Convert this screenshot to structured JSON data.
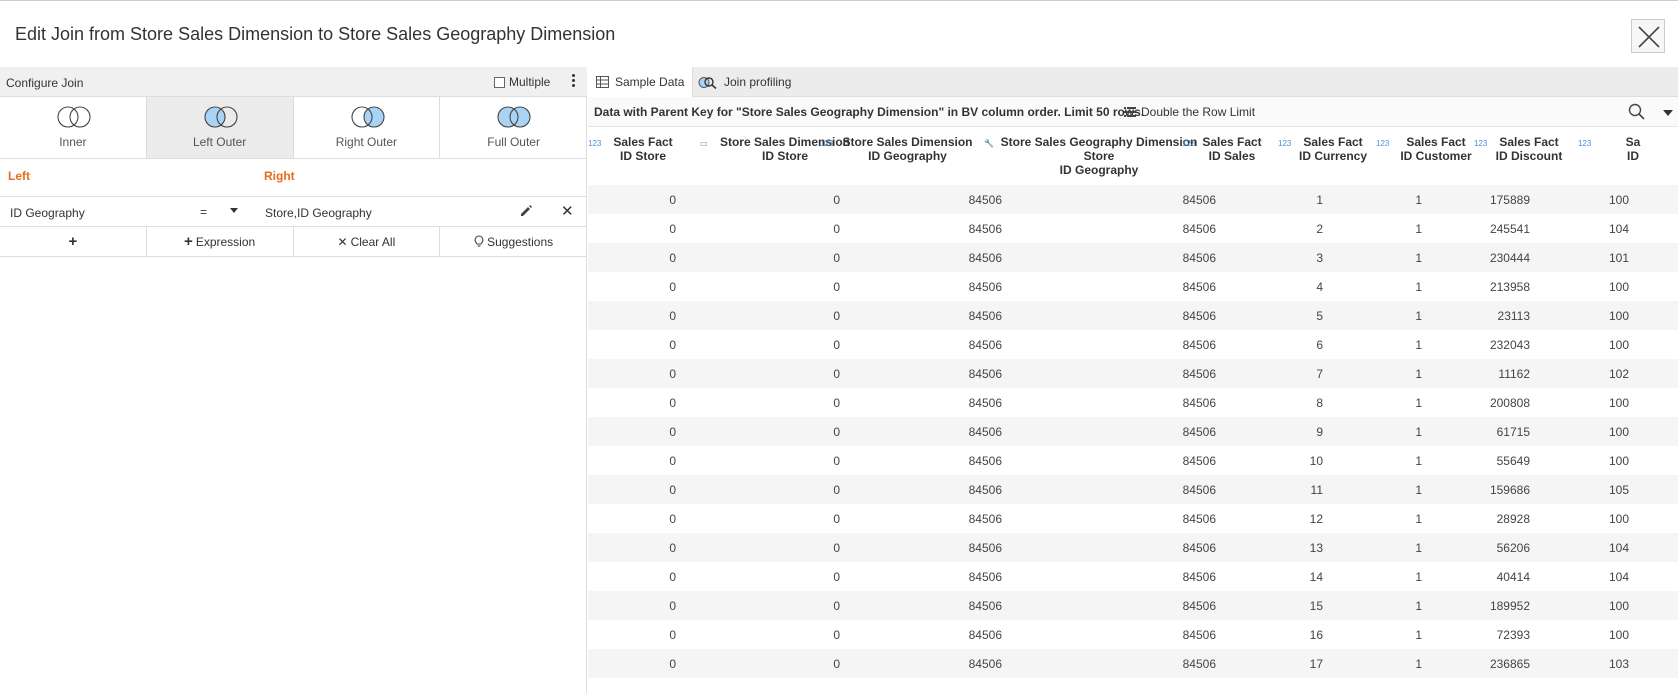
{
  "dialog": {
    "title": "Edit Join from Store Sales Dimension to Store Sales Geography Dimension",
    "close_icon": "close-icon"
  },
  "config": {
    "title": "Configure Join",
    "multiple_label": "Multiple",
    "multiple_checked": false,
    "join_types": [
      {
        "label": "Inner",
        "active": false,
        "fill": "inner"
      },
      {
        "label": "Left Outer",
        "active": true,
        "fill": "left"
      },
      {
        "label": "Right Outer",
        "active": false,
        "fill": "right"
      },
      {
        "label": "Full Outer",
        "active": false,
        "fill": "full"
      }
    ],
    "left_label": "Left",
    "right_label": "Right",
    "condition": {
      "left": "ID Geography",
      "operator": "=",
      "right": "Store,ID Geography"
    },
    "actions": {
      "add": "+",
      "expression": "Expression",
      "clear_all": "Clear All",
      "suggestions": "Suggestions"
    }
  },
  "tabs": [
    {
      "label": "Sample Data",
      "icon": "table-icon",
      "active": true
    },
    {
      "label": "Join profiling",
      "icon": "profiling-icon",
      "active": false
    }
  ],
  "info": {
    "text": "Data with Parent Key for \"Store Sales Geography Dimension\" in BV column order. Limit 50 rows.",
    "double_label": "Double the Row Limit"
  },
  "colors": {
    "accent_orange": "#e86b1f",
    "venn_fill": "#a9d3f5",
    "icon_blue": "#4a90d9"
  },
  "columns": [
    {
      "lines": [
        "Sales Fact",
        "ID Store"
      ],
      "icon": "numeric-icon"
    },
    {
      "lines": [
        "Store Sales Dimension",
        "ID Store"
      ],
      "icon": "key-icon"
    },
    {
      "lines": [
        "Store Sales Dimension",
        "ID Geography"
      ],
      "icon": "numeric-icon"
    },
    {
      "lines": [
        "Store Sales Geography Dimension",
        "Store",
        "ID Geography"
      ],
      "icon": "wrench-key-icon"
    },
    {
      "lines": [
        "Sales Fact",
        "ID Sales"
      ],
      "icon": "numeric-icon"
    },
    {
      "lines": [
        "Sales Fact",
        "ID Currency"
      ],
      "icon": "numeric-icon"
    },
    {
      "lines": [
        "Sales Fact",
        "ID Customer"
      ],
      "icon": "numeric-icon"
    },
    {
      "lines": [
        "Sales Fact",
        "ID Discount"
      ],
      "icon": "numeric-icon"
    },
    {
      "lines": [
        "Sa",
        "ID"
      ],
      "icon": "numeric-icon"
    }
  ],
  "rows": [
    [
      "0",
      "0",
      "84506",
      "84506",
      "1",
      "1",
      "175889",
      "100"
    ],
    [
      "0",
      "0",
      "84506",
      "84506",
      "2",
      "1",
      "245541",
      "104"
    ],
    [
      "0",
      "0",
      "84506",
      "84506",
      "3",
      "1",
      "230444",
      "101"
    ],
    [
      "0",
      "0",
      "84506",
      "84506",
      "4",
      "1",
      "213958",
      "100"
    ],
    [
      "0",
      "0",
      "84506",
      "84506",
      "5",
      "1",
      "23113",
      "100"
    ],
    [
      "0",
      "0",
      "84506",
      "84506",
      "6",
      "1",
      "232043",
      "100"
    ],
    [
      "0",
      "0",
      "84506",
      "84506",
      "7",
      "1",
      "11162",
      "102"
    ],
    [
      "0",
      "0",
      "84506",
      "84506",
      "8",
      "1",
      "200808",
      "100"
    ],
    [
      "0",
      "0",
      "84506",
      "84506",
      "9",
      "1",
      "61715",
      "100"
    ],
    [
      "0",
      "0",
      "84506",
      "84506",
      "10",
      "1",
      "55649",
      "100"
    ],
    [
      "0",
      "0",
      "84506",
      "84506",
      "11",
      "1",
      "159686",
      "105"
    ],
    [
      "0",
      "0",
      "84506",
      "84506",
      "12",
      "1",
      "28928",
      "100"
    ],
    [
      "0",
      "0",
      "84506",
      "84506",
      "13",
      "1",
      "56206",
      "104"
    ],
    [
      "0",
      "0",
      "84506",
      "84506",
      "14",
      "1",
      "40414",
      "104"
    ],
    [
      "0",
      "0",
      "84506",
      "84506",
      "15",
      "1",
      "189952",
      "100"
    ],
    [
      "0",
      "0",
      "84506",
      "84506",
      "16",
      "1",
      "72393",
      "100"
    ],
    [
      "0",
      "0",
      "84506",
      "84506",
      "17",
      "1",
      "236865",
      "103"
    ]
  ]
}
